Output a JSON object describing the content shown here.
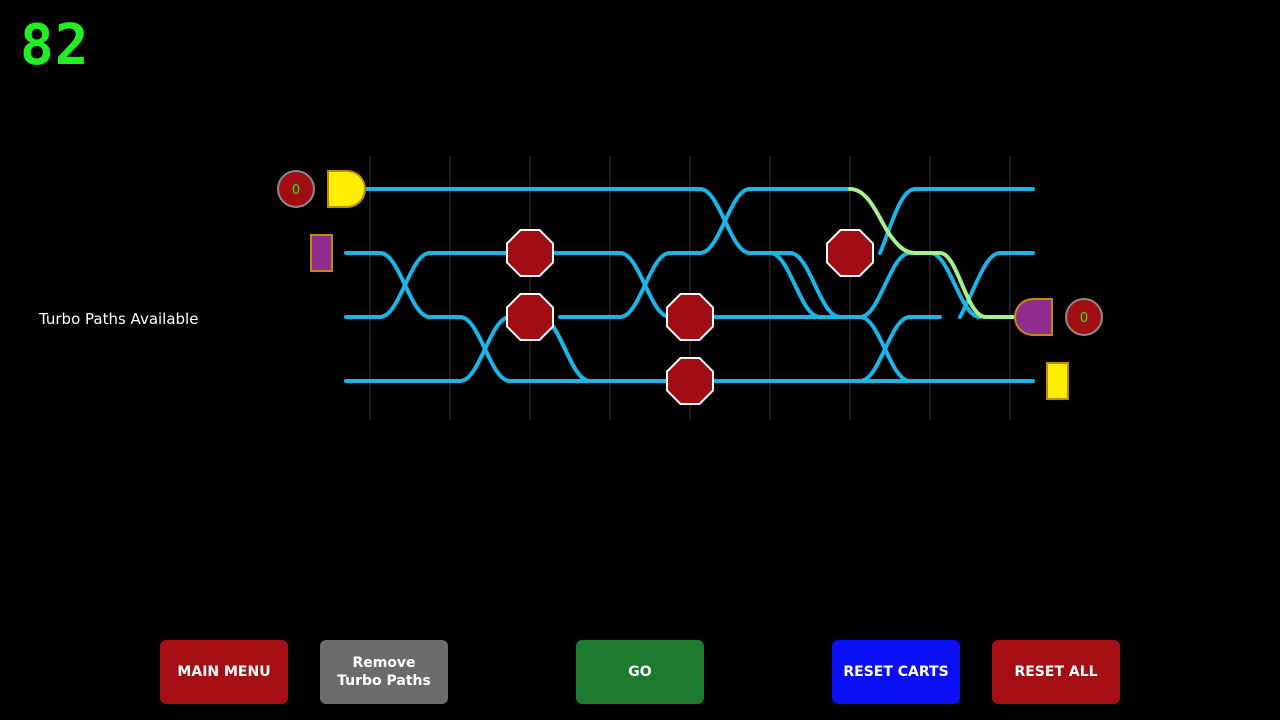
{
  "hud": {
    "counter": "82",
    "turbo_status": "Turbo Paths Available"
  },
  "left_station": {
    "score": "0",
    "gate_color": "#ffee00",
    "cart_color": "#8e2b8c"
  },
  "right_station": {
    "score": "0",
    "gate_color": "#8e2b8c",
    "cart_color": "#ffee00"
  },
  "colors": {
    "track": "#1ab4e8",
    "turbo_track": "#a8f08c",
    "stop_sign": "#a10d12",
    "grid_line": "#3a3a3a",
    "score_text": "#22ee22"
  },
  "buttons": {
    "main_menu": {
      "label": "MAIN MENU",
      "color": "#a50f13"
    },
    "remove_turbo": {
      "line1": "Remove",
      "line2": "Turbo Paths",
      "color": "#6b6b6b"
    },
    "go": {
      "label": "GO",
      "color": "#1d7a2f"
    },
    "reset_carts": {
      "label": "RESET CARTS",
      "color": "#0a0ff5"
    },
    "reset_all": {
      "label": "RESET ALL",
      "color": "#a50f13"
    }
  }
}
